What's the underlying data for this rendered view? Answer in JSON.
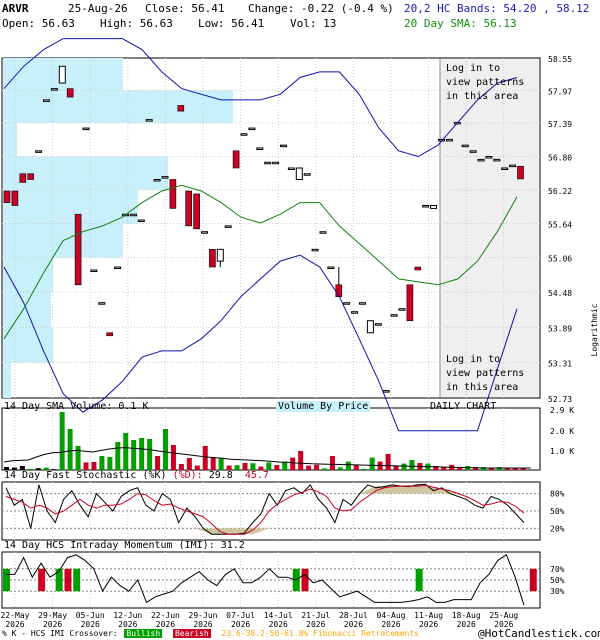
{
  "header": {
    "symbol": "ARVR",
    "date": "25-Aug-26",
    "close_label": "Close: 56.41",
    "change_label": "Change: -0.22 (-0.4 %)",
    "open_label": "Open: 56.63",
    "high_label": "High: 56.63",
    "low_label": "Low: 56.41",
    "vol_label": "Vol: 13",
    "bands_label": "20,2 HC Bands: 54.20 , 58.12",
    "sma_label": "20 Day SMA: 56.13"
  },
  "price_panel": {
    "pattern_note_top": [
      "Log in to",
      "view patterns",
      "in this area"
    ],
    "pattern_note_bottom": [
      "Log in to",
      "view patterns",
      "in this area"
    ],
    "scale_label": "Logarithmic"
  },
  "volume_panel": {
    "title": "14 Day SMA Volume: 0.1 K",
    "vbp_label": "Volume By Price",
    "chart_label": "DAILY CHART",
    "ticks": [
      "2.9 K",
      "2.0 K",
      "1.0 K"
    ]
  },
  "stoch_panel": {
    "title_prefix": "14 Day Fast Stochastic (%K)",
    "title_d": "(%D):",
    "k_value": "29.8",
    "d_value": "45.7",
    "ticks": [
      "80%",
      "50%",
      "20%"
    ]
  },
  "imi_panel": {
    "title": "14 Day HCS Intraday Momentum (IMI): 31.2",
    "ticks": [
      "70%",
      "50%",
      "30%"
    ]
  },
  "footer": {
    "legend_prefix": "% K - HCS IMI Crossover:",
    "bullish": "Bullish",
    "bearish": "Bearish",
    "fib": "23.6-38.2-50-61.8% Fibonacci Retracements",
    "copyright": "@HotCandlestick.com"
  },
  "colors": {
    "bull": "#00a000",
    "bear": "#cc0022",
    "band": "#1010b0",
    "sma": "#108010",
    "vbp": "#c8f0fa",
    "shade": "#efefef",
    "header_blue": "#1a1ab4",
    "header_green": "#109010",
    "fib": "#ffa500"
  },
  "chart_data": {
    "type": "candlestick",
    "scale": "log",
    "price_ticks": [
      58.55,
      57.97,
      57.39,
      56.8,
      56.22,
      55.64,
      55.06,
      54.48,
      53.89,
      53.31,
      52.73
    ],
    "ylim": [
      52.73,
      58.55
    ],
    "x_labels": [
      {
        "top": "22-May",
        "bottom": "2026"
      },
      {
        "top": "29-May",
        "bottom": "2026"
      },
      {
        "top": "05-Jun",
        "bottom": "2026"
      },
      {
        "top": "12-Jun",
        "bottom": "2026"
      },
      {
        "top": "22-Jun",
        "bottom": "2026"
      },
      {
        "top": "29-Jun",
        "bottom": "2026"
      },
      {
        "top": "07-Jul",
        "bottom": "2026"
      },
      {
        "top": "14-Jul",
        "bottom": "2026"
      },
      {
        "top": "21-Jul",
        "bottom": "2026"
      },
      {
        "top": "28-Jul",
        "bottom": "2026"
      },
      {
        "top": "04-Aug",
        "bottom": "2026"
      },
      {
        "top": "11-Aug",
        "bottom": "2026"
      },
      {
        "top": "18-Aug",
        "bottom": "2026"
      },
      {
        "top": "25-Aug",
        "bottom": "2026"
      }
    ],
    "candles": [
      {
        "o": 56.2,
        "h": 56.2,
        "l": 56.0,
        "c": 56.0
      },
      {
        "o": 56.2,
        "h": 56.2,
        "l": 55.95,
        "c": 55.95
      },
      {
        "o": 56.5,
        "h": 56.5,
        "l": 56.35,
        "c": 56.35
      },
      {
        "o": 56.5,
        "h": 56.5,
        "l": 56.4,
        "c": 56.4
      },
      {
        "o": 56.9,
        "h": 56.9,
        "l": 56.9,
        "c": 56.9
      },
      {
        "o": 57.8,
        "h": 57.8,
        "l": 57.8,
        "c": 57.8
      },
      {
        "o": 58.0,
        "h": 58.0,
        "l": 58.0,
        "c": 58.0
      },
      {
        "o": 58.1,
        "h": 58.4,
        "l": 58.1,
        "c": 58.4
      },
      {
        "o": 58.0,
        "h": 58.0,
        "l": 57.85,
        "c": 57.85
      },
      {
        "o": 55.8,
        "h": 55.8,
        "l": 54.6,
        "c": 54.6
      },
      {
        "o": 57.3,
        "h": 57.3,
        "l": 57.3,
        "c": 57.3
      },
      {
        "o": 54.85,
        "h": 54.85,
        "l": 54.85,
        "c": 54.85
      },
      {
        "o": 54.3,
        "h": 54.3,
        "l": 54.3,
        "c": 54.3
      },
      {
        "o": 53.8,
        "h": 53.8,
        "l": 53.75,
        "c": 53.75
      },
      {
        "o": 54.9,
        "h": 54.9,
        "l": 54.9,
        "c": 54.9
      },
      {
        "o": 55.8,
        "h": 55.8,
        "l": 55.8,
        "c": 55.8
      },
      {
        "o": 55.8,
        "h": 55.8,
        "l": 55.8,
        "c": 55.8
      },
      {
        "o": 55.7,
        "h": 55.7,
        "l": 55.7,
        "c": 55.7
      },
      {
        "o": 57.45,
        "h": 57.45,
        "l": 57.45,
        "c": 57.45
      },
      {
        "o": 56.4,
        "h": 56.4,
        "l": 56.4,
        "c": 56.4
      },
      {
        "o": 56.45,
        "h": 56.45,
        "l": 56.45,
        "c": 56.45
      },
      {
        "o": 56.4,
        "h": 56.4,
        "l": 55.9,
        "c": 55.9
      },
      {
        "o": 57.7,
        "h": 57.7,
        "l": 57.6,
        "c": 57.6
      },
      {
        "o": 56.2,
        "h": 56.2,
        "l": 55.6,
        "c": 55.6
      },
      {
        "o": 56.15,
        "h": 56.15,
        "l": 55.55,
        "c": 55.55
      },
      {
        "o": 55.5,
        "h": 55.5,
        "l": 55.5,
        "c": 55.5
      },
      {
        "o": 55.2,
        "h": 55.2,
        "l": 54.9,
        "c": 54.9
      },
      {
        "o": 55.0,
        "h": 55.2,
        "l": 54.9,
        "c": 55.2
      },
      {
        "o": 55.6,
        "h": 55.6,
        "l": 55.6,
        "c": 55.6
      },
      {
        "o": 56.9,
        "h": 56.9,
        "l": 56.6,
        "c": 56.6
      },
      {
        "o": 57.2,
        "h": 57.2,
        "l": 57.2,
        "c": 57.2
      },
      {
        "o": 57.3,
        "h": 57.3,
        "l": 57.3,
        "c": 57.3
      },
      {
        "o": 56.95,
        "h": 56.95,
        "l": 56.95,
        "c": 56.95
      },
      {
        "o": 56.7,
        "h": 56.7,
        "l": 56.7,
        "c": 56.7
      },
      {
        "o": 56.7,
        "h": 56.7,
        "l": 56.7,
        "c": 56.7
      },
      {
        "o": 57.0,
        "h": 57.0,
        "l": 57.0,
        "c": 57.0
      },
      {
        "o": 56.6,
        "h": 56.6,
        "l": 56.6,
        "c": 56.6
      },
      {
        "o": 56.4,
        "h": 56.6,
        "l": 56.4,
        "c": 56.6
      },
      {
        "o": 56.5,
        "h": 56.5,
        "l": 56.5,
        "c": 56.5
      },
      {
        "o": 55.2,
        "h": 55.2,
        "l": 55.2,
        "c": 55.2
      },
      {
        "o": 55.5,
        "h": 55.5,
        "l": 55.5,
        "c": 55.5
      },
      {
        "o": 54.9,
        "h": 54.9,
        "l": 54.9,
        "c": 54.9
      },
      {
        "o": 54.6,
        "h": 54.9,
        "l": 54.4,
        "c": 54.4
      },
      {
        "o": 54.3,
        "h": 54.3,
        "l": 54.3,
        "c": 54.3
      },
      {
        "o": 54.15,
        "h": 54.15,
        "l": 54.15,
        "c": 54.15
      },
      {
        "o": 54.3,
        "h": 54.3,
        "l": 54.3,
        "c": 54.3
      },
      {
        "o": 53.8,
        "h": 54.0,
        "l": 53.8,
        "c": 54.0
      },
      {
        "o": 53.95,
        "h": 53.95,
        "l": 53.95,
        "c": 53.95
      },
      {
        "o": 52.85,
        "h": 52.85,
        "l": 52.85,
        "c": 52.85
      },
      {
        "o": 54.1,
        "h": 54.1,
        "l": 54.1,
        "c": 54.1
      },
      {
        "o": 54.2,
        "h": 54.2,
        "l": 54.2,
        "c": 54.2
      },
      {
        "o": 54.6,
        "h": 54.6,
        "l": 54.0,
        "c": 54.0
      },
      {
        "o": 54.9,
        "h": 54.9,
        "l": 54.85,
        "c": 54.85
      },
      {
        "o": 55.95,
        "h": 55.95,
        "l": 55.95,
        "c": 55.95
      },
      {
        "o": 55.9,
        "h": 55.95,
        "l": 55.9,
        "c": 55.95
      },
      {
        "o": 57.1,
        "h": 57.1,
        "l": 57.1,
        "c": 57.1
      },
      {
        "o": 57.1,
        "h": 57.1,
        "l": 57.1,
        "c": 57.1
      },
      {
        "o": 57.4,
        "h": 57.4,
        "l": 57.4,
        "c": 57.4
      },
      {
        "o": 57.0,
        "h": 57.0,
        "l": 57.0,
        "c": 57.0
      },
      {
        "o": 56.9,
        "h": 56.9,
        "l": 56.9,
        "c": 56.9
      },
      {
        "o": 56.75,
        "h": 56.75,
        "l": 56.75,
        "c": 56.75
      },
      {
        "o": 56.8,
        "h": 56.8,
        "l": 56.8,
        "c": 56.8
      },
      {
        "o": 56.75,
        "h": 56.75,
        "l": 56.75,
        "c": 56.75
      },
      {
        "o": 56.6,
        "h": 56.6,
        "l": 56.6,
        "c": 56.6
      },
      {
        "o": 56.65,
        "h": 56.65,
        "l": 56.65,
        "c": 56.65
      },
      {
        "o": 56.63,
        "h": 56.63,
        "l": 56.41,
        "c": 56.41
      }
    ],
    "band_upper": [
      58.0,
      58.4,
      58.7,
      58.9,
      59.0,
      59.0,
      58.9,
      58.7,
      58.3,
      58.0,
      57.9,
      57.8,
      57.8,
      57.8,
      57.9,
      58.2,
      58.3,
      58.3,
      57.9,
      57.3,
      56.9,
      56.8,
      57.0,
      57.4,
      57.8,
      58.1,
      58.2
    ],
    "band_lower": [
      54.9,
      54.3,
      53.5,
      52.8,
      52.5,
      52.7,
      53.0,
      53.4,
      53.5,
      53.5,
      53.7,
      54.0,
      54.4,
      54.7,
      55.0,
      55.1,
      54.9,
      54.4,
      53.7,
      53.0,
      52.2,
      51.5,
      51.2,
      51.4,
      52.0,
      53.2,
      54.2
    ],
    "sma": [
      53.7,
      54.2,
      54.8,
      55.35,
      55.5,
      55.6,
      55.75,
      56.0,
      56.2,
      56.3,
      56.2,
      56.0,
      55.75,
      55.65,
      55.8,
      56.0,
      56.0,
      55.6,
      55.3,
      55.0,
      54.7,
      54.65,
      54.6,
      54.7,
      55.0,
      55.5,
      56.1
    ],
    "volume_by_price": [
      {
        "price_hi": 58.55,
        "price_lo": 57.97,
        "len": 120
      },
      {
        "price_hi": 57.97,
        "price_lo": 57.39,
        "len": 230
      },
      {
        "price_hi": 57.39,
        "price_lo": 56.8,
        "len": 14
      },
      {
        "price_hi": 56.8,
        "price_lo": 56.22,
        "len": 165
      },
      {
        "price_hi": 56.22,
        "price_lo": 55.64,
        "len": 135
      },
      {
        "price_hi": 55.64,
        "price_lo": 55.06,
        "len": 120
      },
      {
        "price_hi": 55.06,
        "price_lo": 54.48,
        "len": 50
      },
      {
        "price_hi": 54.48,
        "price_lo": 53.89,
        "len": 48
      },
      {
        "price_hi": 53.89,
        "price_lo": 53.31,
        "len": 50
      },
      {
        "price_hi": 53.31,
        "price_lo": 52.73,
        "len": 8
      }
    ],
    "volume": [
      150,
      120,
      200,
      60,
      90,
      120,
      40,
      2900,
      2050,
      1200,
      380,
      400,
      700,
      650,
      1400,
      1850,
      1500,
      1600,
      1550,
      700,
      2050,
      1250,
      300,
      600,
      220,
      1200,
      650,
      620,
      220,
      240,
      350,
      340,
      170,
      380,
      250,
      420,
      620,
      950,
      220,
      260,
      80,
      700,
      130,
      420,
      230,
      60,
      620,
      420,
      800,
      200,
      320,
      500,
      350,
      320,
      200,
      170,
      260,
      100,
      200,
      140,
      140,
      100,
      140,
      120,
      80,
      110
    ],
    "volume_colors": "bbbgbgbgggrrgggggggrgrrrrrrgrgrgrgrgrrrrgrggrggrrrggrgrrrrgrgrgrrr",
    "volume_sma": [
      400,
      460,
      480,
      500,
      650,
      780,
      860,
      880,
      950,
      980,
      940,
      900,
      980,
      1050,
      1100,
      1120,
      1080,
      1050,
      1020,
      950,
      900,
      850,
      800,
      750,
      700,
      650,
      620,
      580,
      540,
      520,
      500,
      480,
      460,
      430,
      400,
      380,
      350,
      330,
      310,
      300,
      290,
      280,
      270,
      260,
      250,
      240,
      230,
      220,
      210,
      200,
      190,
      180,
      170,
      160,
      150,
      140,
      130,
      120,
      110,
      100,
      100,
      100,
      100,
      100,
      100,
      100
    ],
    "stoch_k": [
      90,
      60,
      70,
      20,
      95,
      50,
      30,
      70,
      85,
      60,
      40,
      80,
      65,
      50,
      75,
      85,
      90,
      60,
      50,
      80,
      70,
      30,
      55,
      40,
      20,
      10,
      10,
      10,
      10,
      12,
      30,
      45,
      80,
      60,
      85,
      90,
      80,
      95,
      70,
      55,
      30,
      70,
      60,
      80,
      95,
      90,
      92,
      95,
      93,
      92,
      95,
      96,
      85,
      90,
      80,
      75,
      70,
      60,
      55,
      75,
      70,
      60,
      45,
      30
    ],
    "stoch_d": [
      75,
      70,
      65,
      55,
      60,
      55,
      45,
      50,
      60,
      70,
      60,
      55,
      60,
      60,
      62,
      70,
      80,
      78,
      68,
      60,
      62,
      55,
      50,
      45,
      40,
      28,
      15,
      10,
      10,
      10,
      17,
      30,
      50,
      62,
      70,
      78,
      82,
      88,
      83,
      75,
      55,
      50,
      52,
      65,
      75,
      85,
      90,
      92,
      93,
      93,
      93,
      94,
      91,
      88,
      85,
      80,
      75,
      68,
      60,
      62,
      66,
      65,
      58,
      46
    ],
    "imi": [
      60,
      60,
      90,
      55,
      80,
      55,
      65,
      90,
      95,
      85,
      70,
      30,
      55,
      40,
      30,
      50,
      10,
      20,
      25,
      30,
      45,
      55,
      65,
      50,
      40,
      60,
      70,
      45,
      45,
      55,
      70,
      55,
      55,
      50,
      60,
      45,
      50,
      35,
      20,
      25,
      30,
      20,
      10,
      10,
      10,
      10,
      12,
      15,
      20,
      10,
      10,
      15,
      15,
      15,
      45,
      60,
      85,
      95,
      55,
      5
    ],
    "imi_bars": [
      {
        "i": 0,
        "dir": "bull"
      },
      {
        "i": 4,
        "dir": "bear"
      },
      {
        "i": 6,
        "dir": "bull"
      },
      {
        "i": 7,
        "dir": "bear"
      },
      {
        "i": 8,
        "dir": "bull"
      },
      {
        "i": 33,
        "dir": "bull"
      },
      {
        "i": 34,
        "dir": "bear"
      },
      {
        "i": 47,
        "dir": "bull"
      },
      {
        "i": 60,
        "dir": "bear"
      }
    ]
  }
}
